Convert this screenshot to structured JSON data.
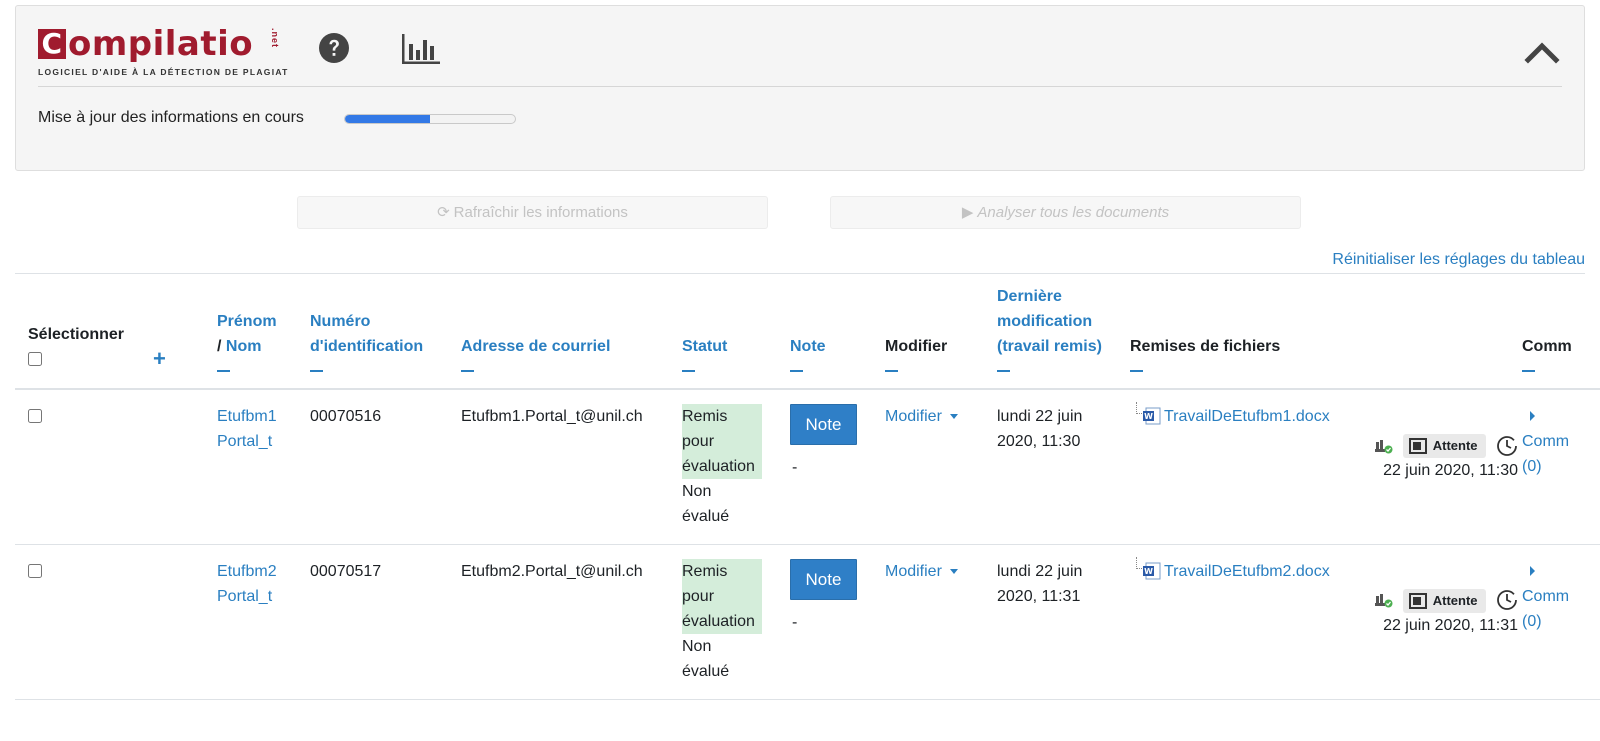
{
  "compilatio": {
    "brand_text": "ompilatio",
    "brand_letter": "C",
    "brand_net": ".net",
    "tagline": "LOGICIEL D'AIDE À LA DÉTECTION DE PLAGIAT",
    "progress_label": "Mise à jour des informations en cours",
    "progress_value": 0.5,
    "brand_color": "#a01b2e",
    "progress_color": "#3379e6"
  },
  "actions": {
    "refresh_label": "Rafraîchir les informations",
    "analyze_label": "Analyser tous les documents",
    "reset_label": "Réinitialiser les réglages du tableau"
  },
  "table": {
    "headers": {
      "select": "Sélectionner",
      "first_name": "Prénom",
      "separator": "/",
      "last_name": "Nom",
      "id_number": "Numéro d'identification",
      "email": "Adresse de courriel",
      "status": "Statut",
      "grade": "Note",
      "edit": "Modifier",
      "last_modified": "Dernière modification (travail remis)",
      "file_submissions": "Remises de fichiers",
      "comments": "Comm"
    },
    "rows": [
      {
        "first_name": "Etufbm1",
        "last_name": "Portal_t",
        "id_number": "00070516",
        "email": "Etufbm1.Portal_t@unil.ch",
        "status_submitted": "Remis pour évaluation",
        "status_grading": "Non évalué",
        "grade_button": "Note",
        "grade_value": "-",
        "edit_label": "Modifier",
        "last_modified": "lundi 22 juin 2020, 11:30",
        "file_name": "TravailDeEtufbm1.docx",
        "analysis_status": "Attente",
        "analysis_date": "22 juin 2020, 11:30",
        "comments_label": "Comm",
        "comments_count": "(0)"
      },
      {
        "first_name": "Etufbm2",
        "last_name": "Portal_t",
        "id_number": "00070517",
        "email": "Etufbm2.Portal_t@unil.ch",
        "status_submitted": "Remis pour évaluation",
        "status_grading": "Non évalué",
        "grade_button": "Note",
        "grade_value": "-",
        "edit_label": "Modifier",
        "last_modified": "lundi 22 juin 2020, 11:31",
        "file_name": "TravailDeEtufbm2.docx",
        "analysis_status": "Attente",
        "analysis_date": "22 juin 2020, 11:31",
        "comments_label": "Comm",
        "comments_count": "(0)"
      }
    ]
  }
}
